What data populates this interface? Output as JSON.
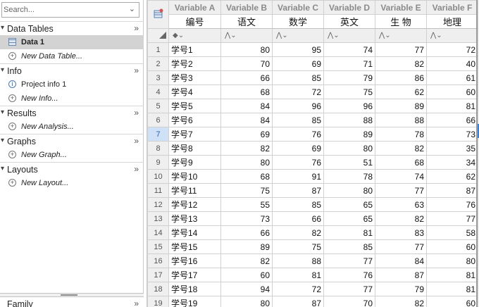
{
  "search": {
    "placeholder": "Search..."
  },
  "sections": [
    {
      "label": "Data Tables",
      "items": [
        {
          "label": "Data 1",
          "icon": "table-icon",
          "selected": true
        },
        {
          "label": "New Data Table...",
          "icon": "add-icon",
          "italic": true
        }
      ]
    },
    {
      "label": "Info",
      "items": [
        {
          "label": "Project info 1",
          "icon": "info-icon"
        },
        {
          "label": "New Info...",
          "icon": "add-icon",
          "italic": true
        }
      ]
    },
    {
      "label": "Results",
      "items": [
        {
          "label": "New Analysis...",
          "icon": "add-icon",
          "italic": true
        }
      ]
    },
    {
      "label": "Graphs",
      "items": [
        {
          "label": "New Graph...",
          "icon": "add-icon",
          "italic": true
        }
      ]
    },
    {
      "label": "Layouts",
      "items": [
        {
          "label": "New Layout...",
          "icon": "add-icon",
          "italic": true
        }
      ]
    }
  ],
  "family_label": "Family",
  "sheet": {
    "columns": [
      {
        "header": "Variable A",
        "label": "编号",
        "type_mark": "◆⌄"
      },
      {
        "header": "Variable B",
        "label": "语文",
        "type_mark": "⋀⌄"
      },
      {
        "header": "Variable C",
        "label": "数学",
        "type_mark": "⋀⌄"
      },
      {
        "header": "Variable D",
        "label": "英文",
        "type_mark": "⋀⌄"
      },
      {
        "header": "Variable E",
        "label": "生 物",
        "type_mark": "⋀⌄"
      },
      {
        "header": "Variable F",
        "label": "地理",
        "type_mark": "⋀⌄"
      }
    ],
    "current_row": 7,
    "rows": [
      [
        "1",
        "学号1",
        "80",
        "95",
        "74",
        "77",
        "72"
      ],
      [
        "2",
        "学号2",
        "70",
        "69",
        "71",
        "82",
        "40"
      ],
      [
        "3",
        "学号3",
        "66",
        "85",
        "79",
        "86",
        "61"
      ],
      [
        "4",
        "学号4",
        "68",
        "72",
        "75",
        "62",
        "60"
      ],
      [
        "5",
        "学号5",
        "84",
        "96",
        "96",
        "89",
        "81"
      ],
      [
        "6",
        "学号6",
        "84",
        "85",
        "88",
        "88",
        "66"
      ],
      [
        "7",
        "学号7",
        "69",
        "76",
        "89",
        "78",
        "73"
      ],
      [
        "8",
        "学号8",
        "82",
        "69",
        "80",
        "82",
        "35"
      ],
      [
        "9",
        "学号9",
        "80",
        "76",
        "51",
        "68",
        "34"
      ],
      [
        "10",
        "学号10",
        "68",
        "91",
        "78",
        "74",
        "62"
      ],
      [
        "11",
        "学号11",
        "75",
        "87",
        "80",
        "77",
        "87"
      ],
      [
        "12",
        "学号12",
        "55",
        "85",
        "65",
        "63",
        "76"
      ],
      [
        "13",
        "学号13",
        "73",
        "66",
        "65",
        "82",
        "77"
      ],
      [
        "14",
        "学号14",
        "66",
        "82",
        "81",
        "83",
        "58"
      ],
      [
        "15",
        "学号15",
        "89",
        "75",
        "85",
        "77",
        "60"
      ],
      [
        "16",
        "学号16",
        "82",
        "88",
        "77",
        "84",
        "80"
      ],
      [
        "17",
        "学号17",
        "60",
        "81",
        "76",
        "87",
        "81"
      ],
      [
        "18",
        "学号18",
        "94",
        "72",
        "77",
        "79",
        "81"
      ],
      [
        "19",
        "学号19",
        "80",
        "87",
        "70",
        "82",
        "60"
      ]
    ]
  }
}
